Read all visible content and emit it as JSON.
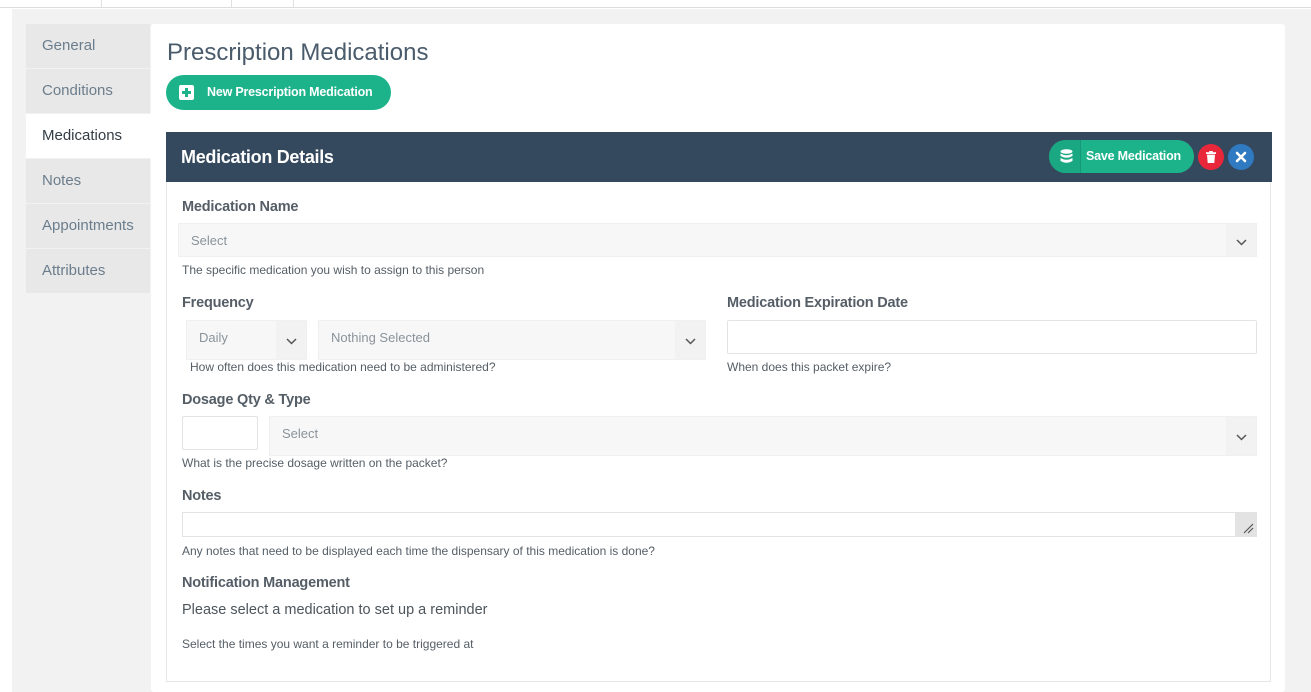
{
  "sidebar": {
    "items": [
      {
        "label": "General"
      },
      {
        "label": "Conditions"
      },
      {
        "label": "Medications"
      },
      {
        "label": "Notes"
      },
      {
        "label": "Appointments"
      },
      {
        "label": "Attributes"
      }
    ]
  },
  "main": {
    "title": "Prescription Medications",
    "new_button_label": "New Prescription Medication"
  },
  "panel": {
    "title": "Medication Details",
    "save_label": "Save Medication"
  },
  "form": {
    "medication_name": {
      "label": "Medication Name",
      "value": "Select",
      "help": "The specific medication you wish to assign to this person"
    },
    "frequency": {
      "label": "Frequency",
      "period_value": "Daily",
      "times_value": "Nothing Selected",
      "help": "How often does this medication need to be administered?"
    },
    "expiration": {
      "label": "Medication Expiration Date",
      "value": "",
      "help": "When does this packet expire?"
    },
    "dosage": {
      "label": "Dosage Qty & Type",
      "qty_value": "",
      "type_value": "Select",
      "help": "What is the precise dosage written on the packet?"
    },
    "notes": {
      "label": "Notes",
      "value": "",
      "help": "Any notes that need to be displayed each time the dispensary of this medication is done?"
    },
    "notification": {
      "label": "Notification Management",
      "message": "Please select a medication to set up a reminder",
      "help": "Select the times you want a reminder to be triggered at"
    }
  },
  "colors": {
    "accent_green": "#1cb38b",
    "header_navy": "#34495e",
    "delete_red": "#e8283a",
    "close_blue": "#2f7ac0"
  },
  "icons": {
    "new_button": "plus-square-icon",
    "save_button": "database-icon",
    "delete_button": "trash-icon",
    "close_button": "close-icon",
    "select_caret": "chevron-down-icon",
    "textarea_resize": "resize-handle-icon"
  }
}
